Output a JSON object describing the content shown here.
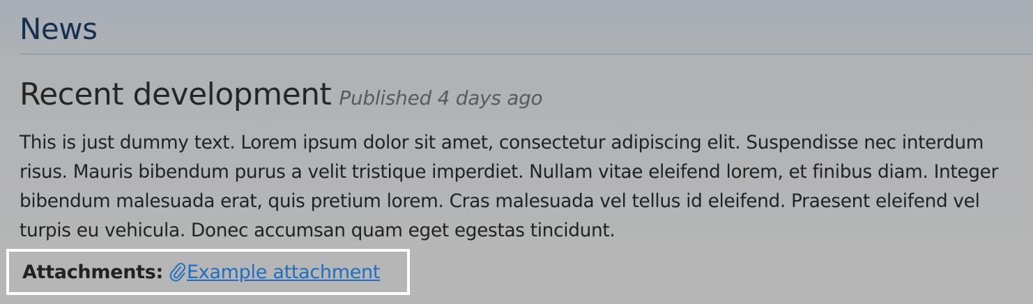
{
  "section": {
    "title": "News"
  },
  "article": {
    "title": "Recent development",
    "meta": "Published 4 days ago",
    "body": "This is just dummy text. Lorem ipsum dolor sit amet, consectetur adipiscing elit. Suspendisse nec interdum risus. Mauris bibendum purus a velit tristique imperdiet. Nullam vitae eleifend lorem, et finibus diam. Integer bibendum malesuada erat, quis pretium lorem. Cras malesuada vel tellus id eleifend. Praesent eleifend vel turpis eu vehicula. Donec accumsan quam eget egestas tincidunt."
  },
  "attachments": {
    "label": "Attachments:",
    "items": [
      {
        "icon": "paperclip-icon",
        "label": "Example attachment"
      }
    ]
  },
  "colors": {
    "section_title": "#14304f",
    "link": "#1d6fc0",
    "highlight_border": "#ffffff"
  }
}
